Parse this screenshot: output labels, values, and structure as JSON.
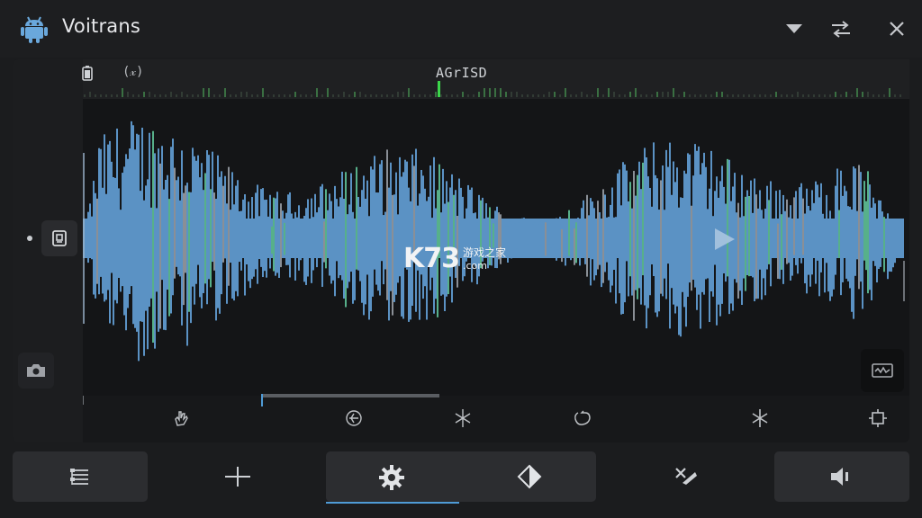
{
  "window": {
    "title": "Voitrans",
    "icons": {
      "app": "android-robot-icon",
      "dropdown": "triangle-down-icon",
      "swap": "swap-arrows-icon",
      "close": "close-icon"
    }
  },
  "ruler": {
    "left_label": "(𝓍)",
    "center_label": "AGrISD",
    "battery_icon": "battery-icon"
  },
  "watermark": {
    "brand": "K73",
    "subtitle": "游戏之家",
    "domain": ".com"
  },
  "waveform": {
    "color": "#5b92c4",
    "accent_color": "#5bd06a",
    "background": "#141517"
  },
  "timeline": {
    "selection_start": 0.216,
    "selection_end": 0.431
  },
  "effects_row": {
    "icons": [
      "hand-icon",
      "rotate-icon",
      "asterisk-icon",
      "loop-icon",
      "sparkle-icon",
      "crop-icon"
    ]
  },
  "sidebar": {
    "icons": [
      "clipboard-icon",
      "camera-icon"
    ]
  },
  "bottom_toolbar": {
    "buttons": [
      {
        "name": "list-settings-button",
        "icon": "sliders-list-icon"
      },
      {
        "name": "split-button",
        "icon": "split-icon"
      },
      {
        "name": "settings-button",
        "icon": "gear-icon",
        "active": true
      },
      {
        "name": "contrast-button",
        "icon": "contrast-icon"
      },
      {
        "name": "tools-button",
        "icon": "tools-icon"
      },
      {
        "name": "volume-button",
        "icon": "speaker-icon"
      }
    ]
  }
}
